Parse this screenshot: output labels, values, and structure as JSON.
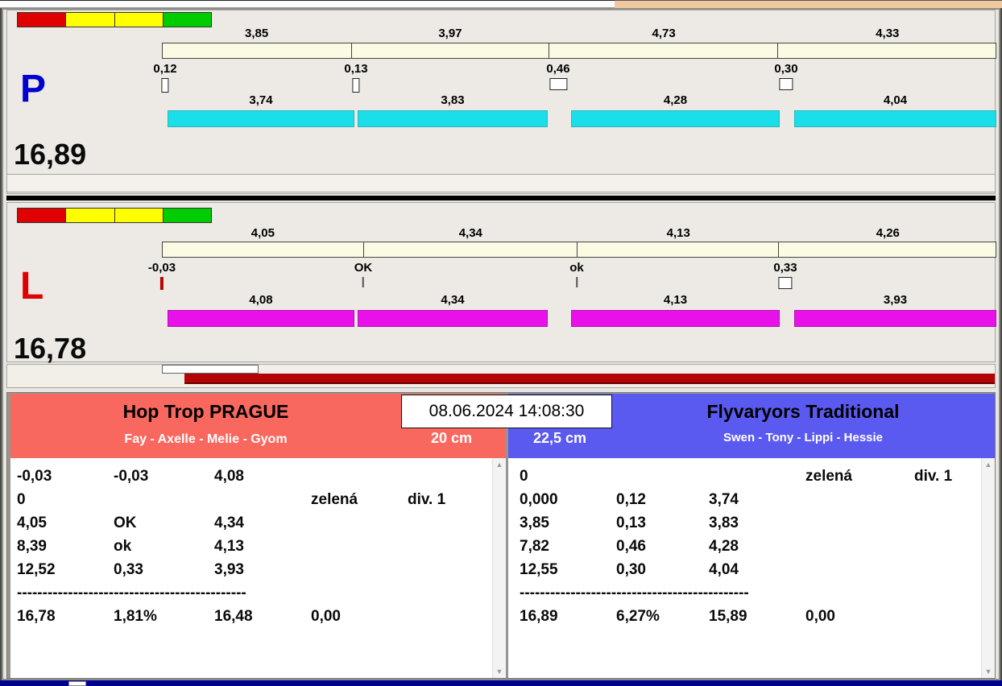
{
  "icons": {
    "scroll_up": "▲",
    "scroll_down": "▼"
  },
  "datetime": "08.06.2024 14:08:30",
  "start_lights": {
    "colors": [
      "#e00000",
      "#ffff00",
      "#ffff00",
      "#00cc00"
    ]
  },
  "lane_p": {
    "label": "P",
    "total": "16,89",
    "letter_color": "#0000cf",
    "bar_color": "#1bdfe8",
    "splits_top": [
      "3,85",
      "3,97",
      "4,73",
      "4,33"
    ],
    "reactions": [
      "0,12",
      "0,13",
      "0,46",
      "0,30"
    ],
    "splits_bottom": [
      "3,74",
      "3,83",
      "4,28",
      "4,04"
    ]
  },
  "lane_l": {
    "label": "L",
    "total": "16,78",
    "letter_color": "#e00000",
    "bar_color": "#e911e9",
    "splits_top": [
      "4,05",
      "4,34",
      "4,13",
      "4,26"
    ],
    "reactions": [
      "-0,03",
      "OK",
      "ok",
      "0,33"
    ],
    "splits_bottom": [
      "4,08",
      "4,34",
      "4,13",
      "3,93"
    ]
  },
  "team_left": {
    "name": "Hop Trop PRAGUE",
    "members": "Fay - Axelle - Melie - Gyom",
    "jump_height": "20 cm",
    "header_color": "#f9685e",
    "rows": [
      [
        "-0,03",
        "-0,03",
        "4,08",
        "",
        ""
      ],
      [
        "0",
        "",
        "",
        "zelená",
        "div. 1"
      ],
      [
        "4,05",
        "OK",
        "4,34",
        "",
        ""
      ],
      [
        "8,39",
        "ok",
        "4,13",
        "",
        ""
      ],
      [
        "12,52",
        "0,33",
        "3,93",
        "",
        ""
      ]
    ],
    "separator": "---------------------------------------------",
    "totals": [
      "16,78",
      "1,81%",
      "16,48",
      "0,00",
      ""
    ]
  },
  "team_right": {
    "name": "Flyvaryors Traditional",
    "members": "Swen - Tony - Lippi - Hessie",
    "jump_height": "22,5 cm",
    "header_color": "#5b5af0",
    "rows": [
      [
        "0",
        "",
        "",
        "zelená",
        "div. 1"
      ],
      [
        "0,000",
        "0,12",
        "3,74",
        "",
        ""
      ],
      [
        "3,85",
        "0,13",
        "3,83",
        "",
        ""
      ],
      [
        "7,82",
        "0,46",
        "4,28",
        "",
        ""
      ],
      [
        "12,55",
        "0,30",
        "4,04",
        "",
        ""
      ]
    ],
    "separator": "---------------------------------------------",
    "totals": [
      "16,89",
      "6,27%",
      "15,89",
      "0,00",
      ""
    ]
  }
}
